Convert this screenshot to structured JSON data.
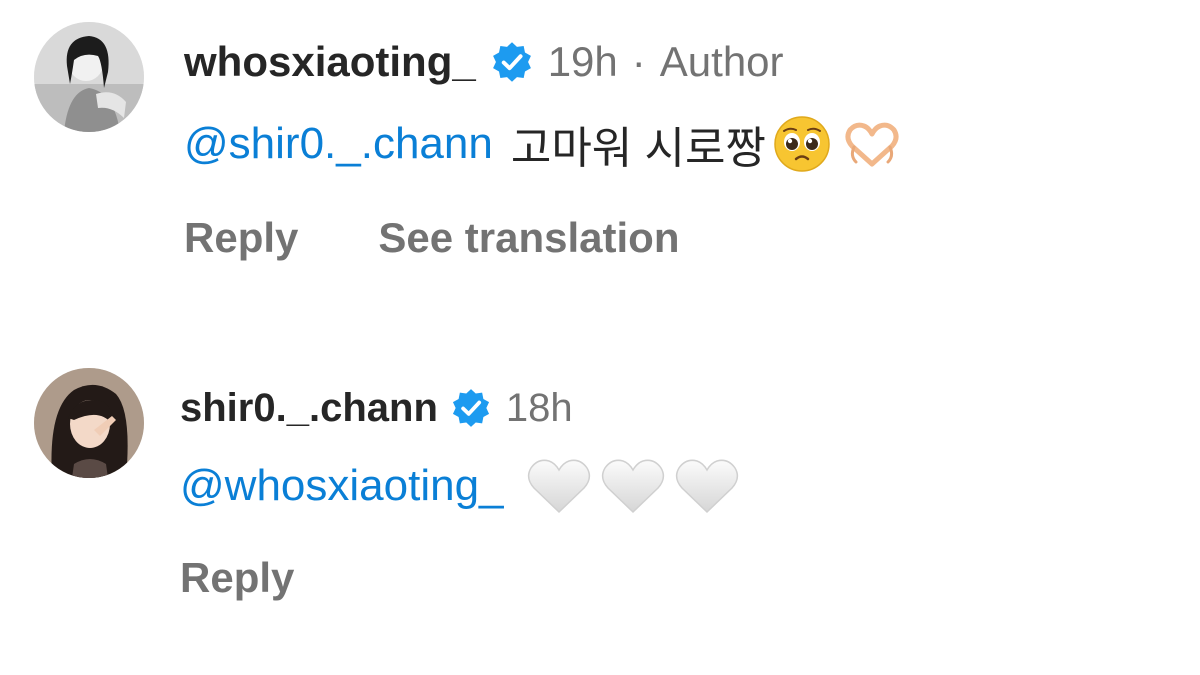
{
  "colors": {
    "mention": "#0a7fd6",
    "verified": "#1d9bf0",
    "meta": "#737373",
    "text": "#262626"
  },
  "comments": [
    {
      "username": "whosxiaoting_",
      "verified_icon": "verified-badge-icon",
      "time": "19h",
      "separator": "·",
      "author_label": "Author",
      "mention": "@shir0._.chann",
      "text": "고마워 시로짱",
      "emojis": [
        "pleading-face-emoji",
        "heart-hands-emoji"
      ],
      "actions": {
        "reply": "Reply",
        "translate": "See translation"
      }
    },
    {
      "username": "shir0._.chann",
      "verified_icon": "verified-badge-icon",
      "time": "18h",
      "mention": "@whosxiaoting_",
      "text": "",
      "emojis": [
        "white-heart-emoji",
        "white-heart-emoji",
        "white-heart-emoji"
      ],
      "actions": {
        "reply": "Reply"
      }
    }
  ]
}
